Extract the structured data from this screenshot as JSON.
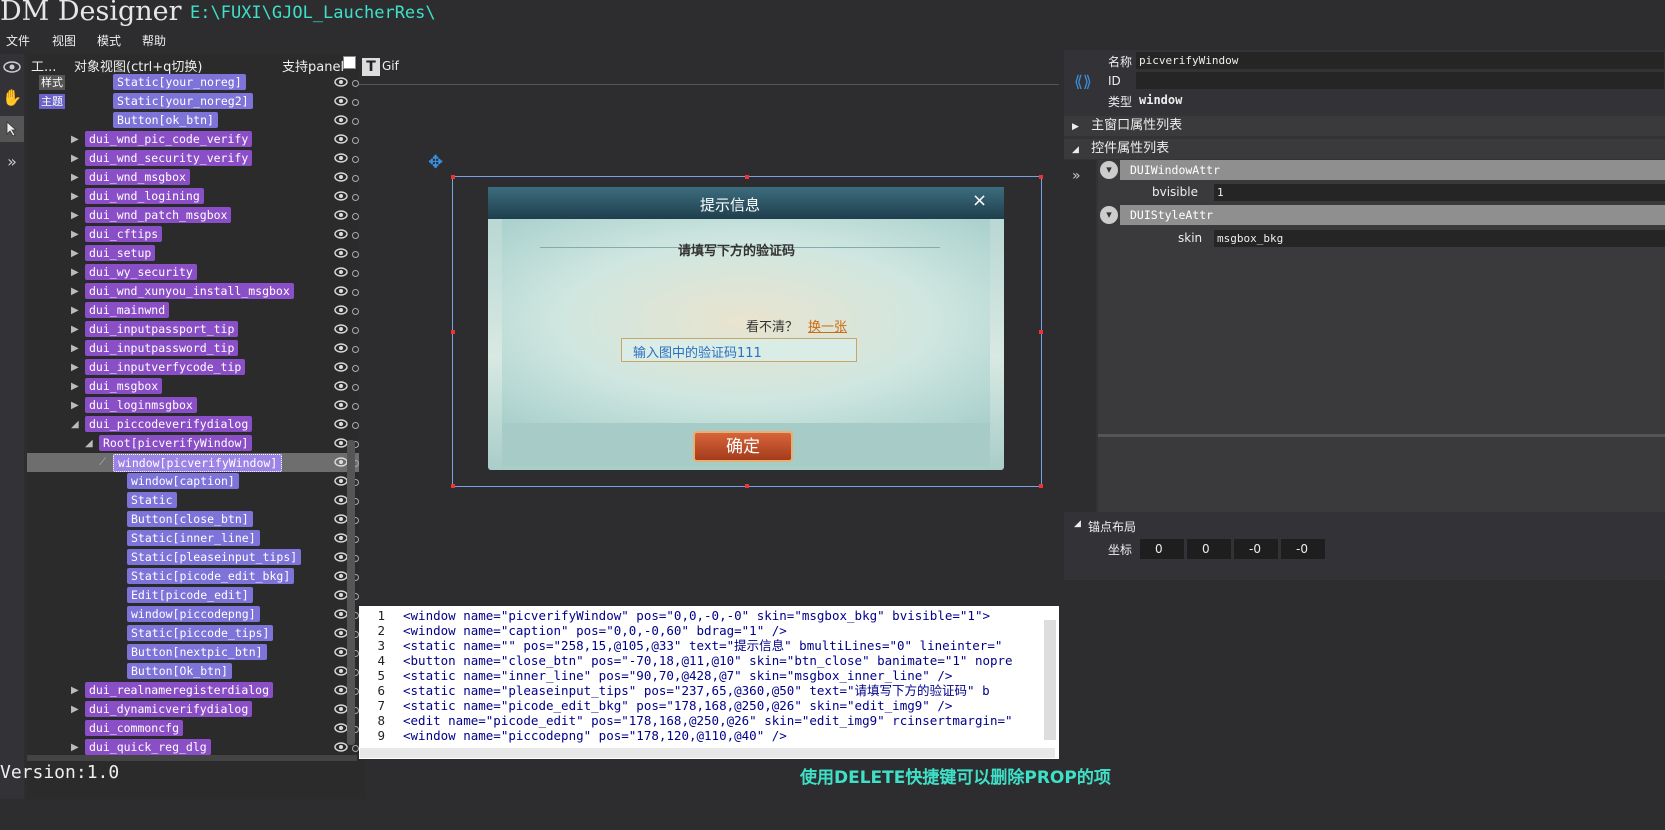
{
  "app": {
    "title": "DM Designer",
    "path": "E:\\FUXI\\GJOL_LaucherRes\\"
  },
  "menu": [
    "文件",
    "视图",
    "模式",
    "帮助"
  ],
  "tree_panel": {
    "tools_header": "工...",
    "header": "对象视图(ctrl+q切换)",
    "support_label": "支持panel",
    "side_tabs": [
      "样式",
      "主题"
    ],
    "items": [
      {
        "label": "Static[your_noreg]",
        "indent": 3,
        "style": "lav",
        "arrow": ""
      },
      {
        "label": "Static[your_noreg2]",
        "indent": 3,
        "style": "lav",
        "arrow": ""
      },
      {
        "label": "Button[ok_btn]",
        "indent": 3,
        "style": "lav",
        "arrow": ""
      },
      {
        "label": "dui_wnd_pic_code_verify",
        "indent": 1,
        "style": "purple",
        "arrow": "▶"
      },
      {
        "label": "dui_wnd_security_verify",
        "indent": 1,
        "style": "purple",
        "arrow": "▶"
      },
      {
        "label": "dui_wnd_msgbox",
        "indent": 1,
        "style": "purple",
        "arrow": "▶"
      },
      {
        "label": "dui_wnd_logining",
        "indent": 1,
        "style": "purple",
        "arrow": "▶"
      },
      {
        "label": "dui_wnd_patch_msgbox",
        "indent": 1,
        "style": "purple",
        "arrow": "▶"
      },
      {
        "label": "dui_cftips",
        "indent": 1,
        "style": "purple",
        "arrow": "▶"
      },
      {
        "label": "dui_setup",
        "indent": 1,
        "style": "purple",
        "arrow": "▶"
      },
      {
        "label": "dui_wy_security",
        "indent": 1,
        "style": "purple",
        "arrow": "▶"
      },
      {
        "label": "dui_wnd_xunyou_install_msgbox",
        "indent": 1,
        "style": "purple",
        "arrow": "▶"
      },
      {
        "label": "dui_mainwnd",
        "indent": 1,
        "style": "purple",
        "arrow": "▶"
      },
      {
        "label": "dui_inputpassport_tip",
        "indent": 1,
        "style": "purple",
        "arrow": "▶"
      },
      {
        "label": "dui_inputpassword_tip",
        "indent": 1,
        "style": "purple",
        "arrow": "▶"
      },
      {
        "label": "dui_inputverfycode_tip",
        "indent": 1,
        "style": "purple",
        "arrow": "▶"
      },
      {
        "label": "dui_msgbox",
        "indent": 1,
        "style": "purple",
        "arrow": "▶"
      },
      {
        "label": "dui_loginmsgbox",
        "indent": 1,
        "style": "purple",
        "arrow": "▶"
      },
      {
        "label": "dui_piccodeverifydialog",
        "indent": 1,
        "style": "purple",
        "arrow": "◢"
      },
      {
        "label": "Root[picverifyWindow]",
        "indent": 2,
        "style": "purple",
        "arrow": "◢"
      },
      {
        "label": "window[picverifyWindow]",
        "indent": 3,
        "style": "selnode",
        "arrow": "⟋",
        "selected": true
      },
      {
        "label": "window[caption]",
        "indent": 4,
        "style": "lav",
        "arrow": ""
      },
      {
        "label": "Static",
        "indent": 4,
        "style": "lav",
        "arrow": ""
      },
      {
        "label": "Button[close_btn]",
        "indent": 4,
        "style": "lav",
        "arrow": ""
      },
      {
        "label": "Static[inner_line]",
        "indent": 4,
        "style": "lav",
        "arrow": ""
      },
      {
        "label": "Static[pleaseinput_tips]",
        "indent": 4,
        "style": "lav",
        "arrow": ""
      },
      {
        "label": "Static[picode_edit_bkg]",
        "indent": 4,
        "style": "lav",
        "arrow": ""
      },
      {
        "label": "Edit[picode_edit]",
        "indent": 4,
        "style": "lav",
        "arrow": ""
      },
      {
        "label": "window[piccodepng]",
        "indent": 4,
        "style": "lav",
        "arrow": ""
      },
      {
        "label": "Static[piccode_tips]",
        "indent": 4,
        "style": "lav",
        "arrow": ""
      },
      {
        "label": "Button[nextpic_btn]",
        "indent": 4,
        "style": "lav",
        "arrow": ""
      },
      {
        "label": "Button[Ok_btn]",
        "indent": 4,
        "style": "lav",
        "arrow": ""
      },
      {
        "label": "dui_realnameregisterdialog",
        "indent": 1,
        "style": "purple",
        "arrow": "▶"
      },
      {
        "label": "dui_dynamicverifydialog",
        "indent": 1,
        "style": "purple",
        "arrow": "▶"
      },
      {
        "label": "dui_commoncfg",
        "indent": 1,
        "style": "purple",
        "arrow": ""
      },
      {
        "label": "dui_quick_reg_dlg",
        "indent": 1,
        "style": "purple",
        "arrow": "▶"
      }
    ]
  },
  "canvas": {
    "gif_label": "Gif",
    "dialog": {
      "title": "提示信息",
      "close": "×",
      "heading": "请填写下方的验证码",
      "hint": "看不清？",
      "nextpic": "换一张",
      "input_value": "输入图中的验证码111",
      "ok_label": "确定"
    }
  },
  "code_editor": {
    "lines": [
      {
        "n": "1",
        "text": "<window name=\"picverifyWindow\" pos=\"0,0,-0,-0\" skin=\"msgbox_bkg\" bvisible=\"1\">"
      },
      {
        "n": "2",
        "text": "    <window name=\"caption\" pos=\"0,0,-0,60\" bdrag=\"1\" />"
      },
      {
        "n": "3",
        "text": "    <static name=\"\" pos=\"258,15,@105,@33\" text=\"提示信息\" bmultiLines=\"0\" lineinter=\""
      },
      {
        "n": "4",
        "text": "    <button name=\"close_btn\" pos=\"-70,18,@11,@10\" skin=\"btn_close\" banimate=\"1\" nopre"
      },
      {
        "n": "5",
        "text": "    <static name=\"inner_line\" pos=\"90,70,@428,@7\" skin=\"msgbox_inner_line\" />"
      },
      {
        "n": "6",
        "text": "    <static name=\"pleaseinput_tips\" pos=\"237,65,@360,@50\" text=\"请填写下方的验证码\" b"
      },
      {
        "n": "7",
        "text": "    <static name=\"picode_edit_bkg\" pos=\"178,168,@250,@26\" skin=\"edit_img9\" />"
      },
      {
        "n": "8",
        "text": "    <edit name=\"picode_edit\" pos=\"178,168,@250,@26\" skin=\"edit_img9\" rcinsertmargin=\""
      },
      {
        "n": "9",
        "text": "    <window name=\"piccodepng\" pos=\"178,120,@110,@40\" />"
      }
    ]
  },
  "properties": {
    "name_label": "名称",
    "name_value": "picverifyWindow",
    "id_label": "ID",
    "id_value": "",
    "type_label": "类型",
    "type_value": "window",
    "main_section": "主窗口属性列表",
    "control_section": "控件属性列表",
    "attr_groups": [
      {
        "title": "DUIWindowAttr",
        "key": "bvisible",
        "value": "1"
      },
      {
        "title": "DUIStyleAttr",
        "key": "skin",
        "value": "msgbox_bkg"
      }
    ],
    "anchor_section": "锚点布局",
    "coord_label": "坐标",
    "coords": [
      "0",
      "0",
      "-0",
      "-0"
    ]
  },
  "status": {
    "version": "Version:1.0",
    "tip": "使用DELETE快捷键可以删除PROP的项"
  }
}
